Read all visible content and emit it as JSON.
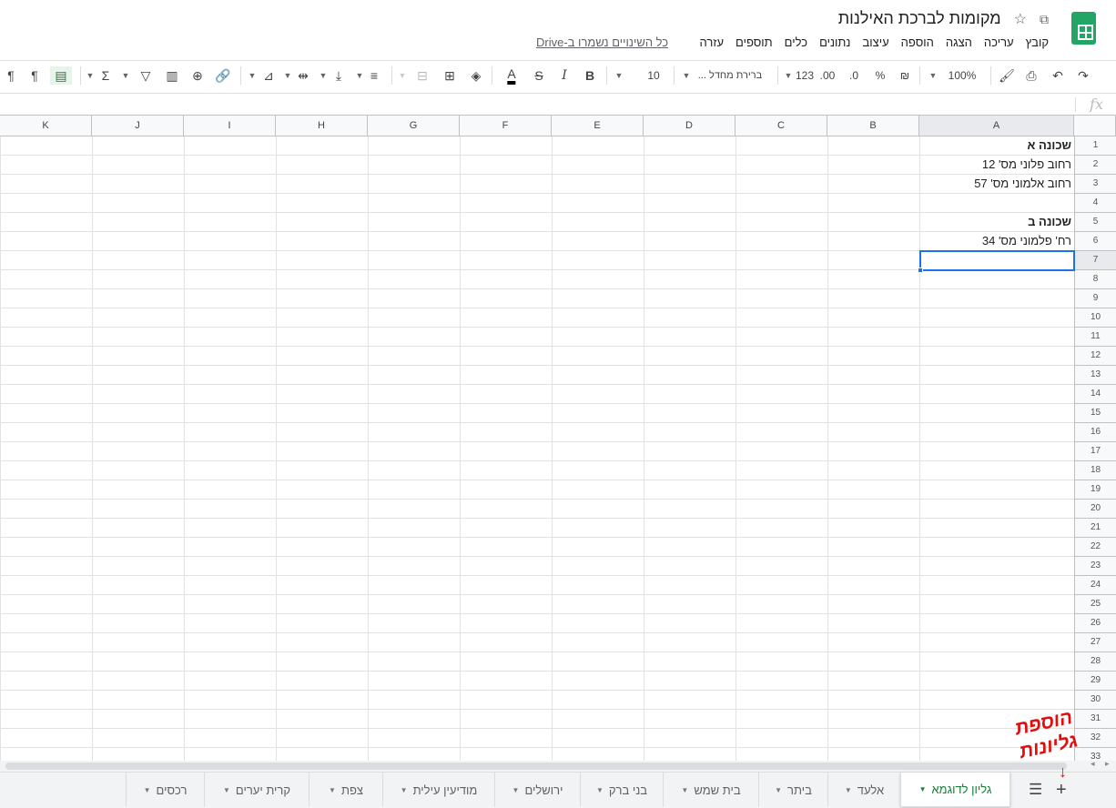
{
  "doc": {
    "title": "מקומות לברכת האילנות",
    "saved_status": "כל השינויים נשמרו ב-Drive"
  },
  "menu": [
    "קובץ",
    "עריכה",
    "הצגה",
    "הוספה",
    "עיצוב",
    "נתונים",
    "כלים",
    "תוספים",
    "עזרה"
  ],
  "toolbar": {
    "zoom": "100%",
    "currency": "₪",
    "percent": "%",
    "dec_less": ".0",
    "dec_more": ".00",
    "format_more": "123",
    "font": "ברירת מחדל ...",
    "font_size": "10",
    "bold": "B",
    "italic": "I",
    "strike": "S",
    "text_color": "A",
    "sum": "Σ"
  },
  "formula": {
    "fx": "fx"
  },
  "columns": [
    "A",
    "B",
    "C",
    "D",
    "E",
    "F",
    "G",
    "H",
    "I",
    "J",
    "K"
  ],
  "row_count": 33,
  "cells": [
    {
      "row": 1,
      "text": "שכונה א",
      "bold": true
    },
    {
      "row": 2,
      "text": "רחוב פלוני מס' 12",
      "bold": false
    },
    {
      "row": 3,
      "text": "רחוב אלמוני מס' 57",
      "bold": false
    },
    {
      "row": 5,
      "text": "שכונה ב",
      "bold": true
    },
    {
      "row": 6,
      "text": "רח' פלמוני מס' 34",
      "bold": false
    }
  ],
  "selected_cell": "A7",
  "sheets": [
    {
      "label": "גליון לדוגמא",
      "active": true
    },
    {
      "label": "אלעד"
    },
    {
      "label": "ביתר"
    },
    {
      "label": "בית שמש"
    },
    {
      "label": "בני ברק"
    },
    {
      "label": "ירושלים"
    },
    {
      "label": "מודיעין עילית"
    },
    {
      "label": "צפת"
    },
    {
      "label": "קרית יערים"
    },
    {
      "label": "רכסים"
    }
  ],
  "annotation": {
    "line1": "הוספת",
    "line2": "גליונות",
    "arrow": "↓",
    "color": "#e10e0e"
  }
}
